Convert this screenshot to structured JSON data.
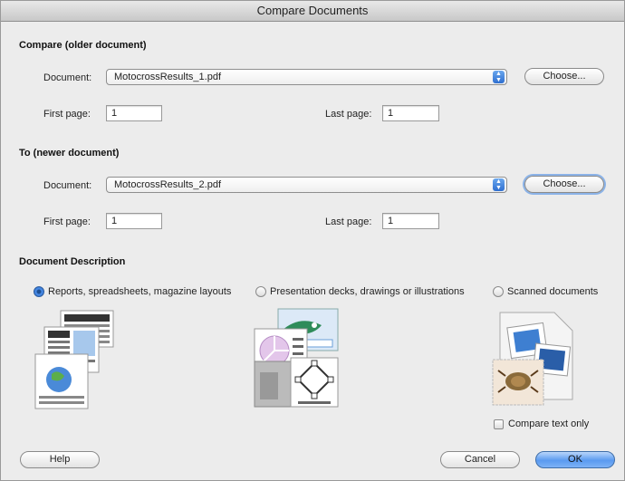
{
  "window": {
    "title": "Compare Documents"
  },
  "older": {
    "section_title": "Compare (older document)",
    "document_label": "Document:",
    "document_value": "MotocrossResults_1.pdf",
    "choose_label": "Choose...",
    "first_page_label": "First page:",
    "first_page_value": "1",
    "last_page_label": "Last page:",
    "last_page_value": "1"
  },
  "newer": {
    "section_title": "To (newer document)",
    "document_label": "Document:",
    "document_value": "MotocrossResults_2.pdf",
    "choose_label": "Choose...",
    "first_page_label": "First page:",
    "first_page_value": "1",
    "last_page_label": "Last page:",
    "last_page_value": "1"
  },
  "description": {
    "section_title": "Document Description",
    "options": [
      {
        "label": "Reports, spreadsheets, magazine layouts",
        "selected": true
      },
      {
        "label": "Presentation decks, drawings or illustrations",
        "selected": false
      },
      {
        "label": "Scanned documents",
        "selected": false
      }
    ]
  },
  "compare_text_only": {
    "label": "Compare text only",
    "checked": false
  },
  "footer": {
    "help_label": "Help",
    "cancel_label": "Cancel",
    "ok_label": "OK"
  },
  "colors": {
    "accent": "#2f6fd0",
    "background": "#ececec"
  }
}
